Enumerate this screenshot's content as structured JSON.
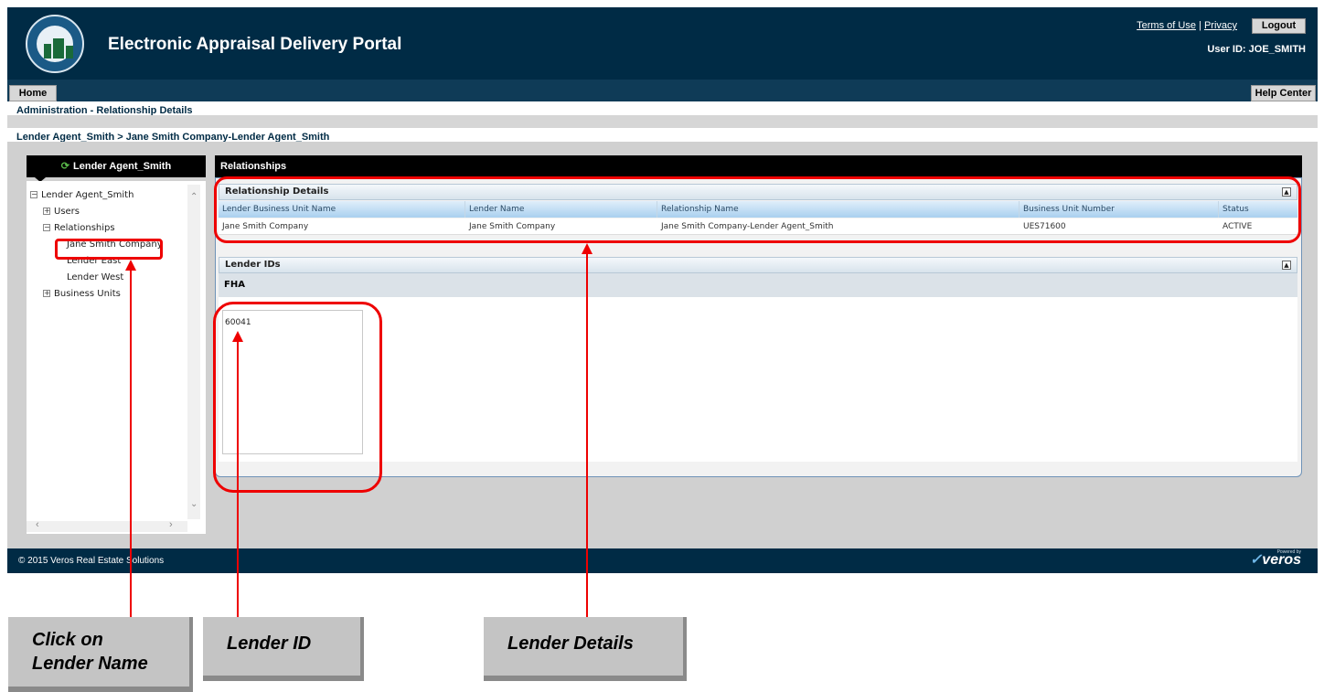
{
  "header": {
    "title": "Electronic Appraisal Delivery Portal",
    "terms": "Terms of Use",
    "separator": "|",
    "privacy": "Privacy",
    "logout": "Logout",
    "user_id": "User ID: JOE_SMITH"
  },
  "nav": {
    "home": "Home",
    "help": "Help Center",
    "subtitle": "Administration - Relationship Details",
    "breadcrumb": "Lender Agent_Smith > Jane Smith Company-Lender Agent_Smith"
  },
  "left": {
    "tab": "Lender Agent_Smith",
    "tree": {
      "root": "Lender Agent_Smith",
      "users": "Users",
      "relationships": "Relationships",
      "rel_items": [
        "Jane Smith Company",
        "Lender East",
        "Lender West"
      ],
      "business_units": "Business Units"
    }
  },
  "right": {
    "header": "Relationships",
    "details_title": "Relationship Details",
    "columns": [
      "Lender Business Unit Name",
      "Lender Name",
      "Relationship Name",
      "Business Unit Number",
      "Status"
    ],
    "row": [
      "Jane Smith Company",
      "Jane Smith Company",
      "Jane Smith Company-Lender Agent_Smith",
      "UES71600",
      "ACTIVE"
    ],
    "lender_ids_title": "Lender IDs",
    "fha_label": "FHA",
    "lender_id_value": "60041"
  },
  "footer": {
    "copyright": "© 2015 Veros Real Estate Solutions",
    "logo": "veros",
    "powered": "Powered by"
  },
  "callouts": {
    "click": "Click on\nLender Name",
    "lender_id": "Lender ID",
    "lender_details": "Lender Details"
  }
}
